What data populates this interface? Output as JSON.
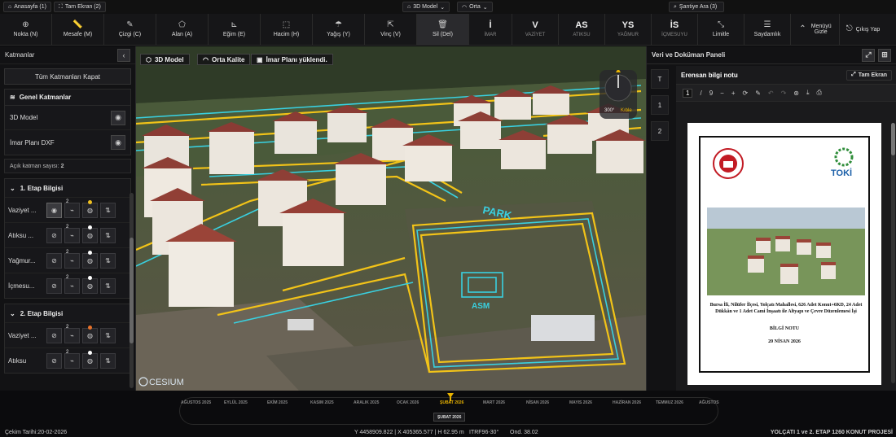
{
  "topbar": {
    "home": "Anasayfa (1)",
    "fullscreen": "Tam Ekran (2)",
    "view_mode": "3D Model",
    "quality": "Orta",
    "site_search": "Şantiye Ara (3)"
  },
  "tools": [
    {
      "icon": "⊕",
      "label": "Nokta (N)"
    },
    {
      "icon": "📏",
      "label": "Mesafe (M)"
    },
    {
      "icon": "✎",
      "label": "Çizgi (C)"
    },
    {
      "icon": "⬠",
      "label": "Alan (A)"
    },
    {
      "icon": "⊾",
      "label": "Eğim (E)"
    },
    {
      "icon": "⬚",
      "label": "Hacim (H)"
    },
    {
      "icon": "☂",
      "label": "Yağış (Y)"
    },
    {
      "icon": "⇱",
      "label": "Vinç (V)"
    },
    {
      "icon": "🗑",
      "label": "Sil (Del)"
    }
  ],
  "layer_tools": [
    {
      "abbr": "İ",
      "label": "İMAR"
    },
    {
      "abbr": "V",
      "label": "VAZİYET"
    },
    {
      "abbr": "AS",
      "label": "ATIKSU"
    },
    {
      "abbr": "YS",
      "label": "YAĞMUR"
    },
    {
      "abbr": "İS",
      "label": "İÇMESUYU"
    }
  ],
  "right_tools": {
    "limits": "Limitle",
    "transparency": "Saydamlık",
    "menu_hide": "Menüyü Gizle",
    "logout": "Çıkış Yap"
  },
  "left": {
    "title": "Katmanlar",
    "close_all": "Tüm Katmanları Kapat",
    "general_title": "Genel Katmanlar",
    "general_items": [
      "3D Model",
      "İmar Planı DXF"
    ],
    "open_count_label": "Açık katman sayısı:",
    "open_count": "2",
    "etap1_title": "1. Etap Bilgisi",
    "etap1_rows": [
      {
        "name": "Vaziyet ...",
        "badge": "2",
        "dot": "#f0c020",
        "visible": true
      },
      {
        "name": "Atıksu ...",
        "badge": "2",
        "dot": "#ffffff",
        "visible": false
      },
      {
        "name": "Yağmur...",
        "badge": "2",
        "dot": "#ffffff",
        "visible": false
      },
      {
        "name": "İçmesu...",
        "badge": "2",
        "dot": "#ffffff",
        "visible": false
      }
    ],
    "etap2_title": "2. Etap Bilgisi",
    "etap2_rows": [
      {
        "name": "Vaziyet ...",
        "badge": "2",
        "dot": "#e8722a",
        "visible": false
      },
      {
        "name": "Atıksu",
        "badge": "2",
        "dot": "#ffffff",
        "visible": false
      }
    ]
  },
  "map": {
    "tab_3d": "3D Model",
    "tab_quality": "Orta Kalite",
    "tab_plan": "İmar Planı yüklendi.",
    "compass_deg": "300°",
    "compass_dir": "Kıble",
    "label_park": "PARK",
    "label_asm": "ASM",
    "cesium": "CESIUM"
  },
  "right": {
    "title": "Veri ve Doküman Paneli",
    "side_tabs": [
      "T",
      "1",
      "2"
    ],
    "doc_title": "Erensan bilgi notu",
    "doc_fullscreen": "Tam Ekran",
    "page_current": "1",
    "page_sep": "/",
    "page_total": "9",
    "doc_subject": "Bursa İli, Nilüfer İlçesi, Yolçatı Mahallesi, 626 Adet Konut+6KD, 24 Adet Dükkân ve 1 Adet Cami İnşaatı ile Altyapı ve Çevre Düzenlemesi İşi",
    "doc_heading": "BİLGİ NOTU",
    "doc_date": "20 NİSAN 2026",
    "toki": "TOKİ"
  },
  "timeline": {
    "months": [
      "AĞUSTOS 2025",
      "EYLÜL 2025",
      "EKİM 2025",
      "KASIM 2025",
      "ARALIK 2025",
      "OCAK 2026",
      "ŞUBAT 2026",
      "MART 2026",
      "NİSAN 2026",
      "MAYIS 2026",
      "HAZİRAN 2026",
      "TEMMUZ 2026",
      "AĞUSTOS"
    ],
    "selected": "ŞUBAT 2026"
  },
  "status": {
    "capture_date": "Çekim Tarihi:20-02-2026",
    "coords": "Y 4458909.822 | X 405365.577 | H 62.95 m",
    "datum": "ITRF96-30°",
    "ond": "Ond. 38.02",
    "project": "YOLÇATI 1 ve 2. ETAP 1260 KONUT PROJESİ"
  },
  "colors": {
    "accent": "#e9b300",
    "plan_yellow": "#f2c318",
    "plan_cyan": "#39d0e0"
  }
}
